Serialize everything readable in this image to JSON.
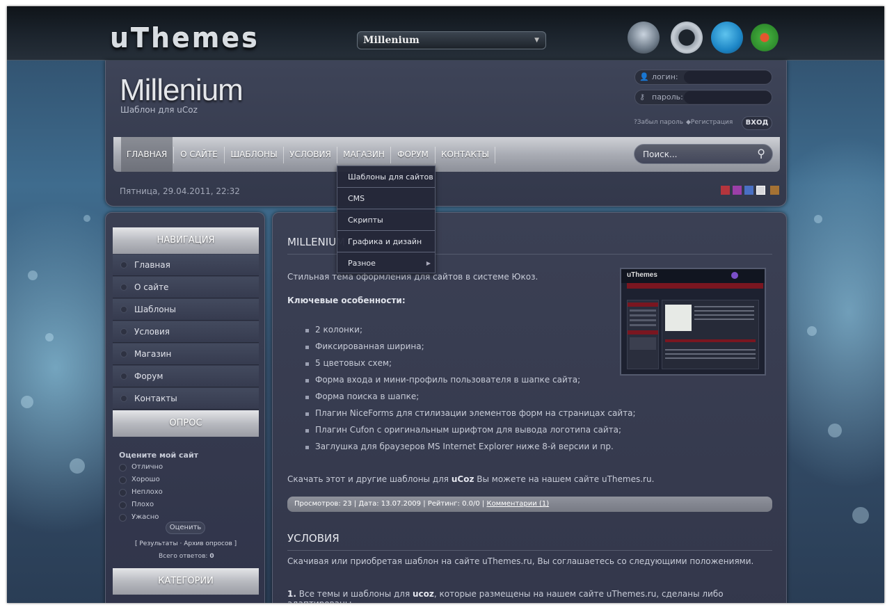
{
  "topbar": {
    "logo": "uThemes",
    "theme_select_value": "Millenium"
  },
  "header": {
    "site_title": "Millenium",
    "site_subtitle": "Шаблон для uCoz",
    "login_label": "логин:",
    "password_label": "пароль:",
    "forgot_link": "Забыл пароль",
    "register_link": "Регистрация",
    "login_button": "ВХОД",
    "search_placeholder": "Поиск...",
    "date": "Пятница, 29.04.2011, 22:32",
    "color_swatches": [
      "#b4353d",
      "#9b3fa8",
      "#4a70c4",
      "#d8d8dc",
      "#a57234"
    ]
  },
  "menu": {
    "items": [
      "ГЛАВНАЯ",
      "О САЙТЕ",
      "ШАБЛОНЫ",
      "УСЛОВИЯ",
      "МАГАЗИН",
      "ФОРУМ",
      "КОНТАКТЫ"
    ],
    "dropdown": [
      "Шаблоны для сайтов",
      "CMS",
      "Скрипты",
      "Графика и дизайн",
      "Разное"
    ]
  },
  "sidebar": {
    "nav_title": "НАВИГАЦИЯ",
    "nav_items": [
      "Главная",
      "О сайте",
      "Шаблоны",
      "Условия",
      "Магазин",
      "Форум",
      "Контакты"
    ],
    "poll_title": "ОПРОС",
    "poll_question": "Оцените мой сайт",
    "poll_options": [
      "Отлично",
      "Хорошо",
      "Неплохо",
      "Плохо",
      "Ужасно"
    ],
    "vote_button": "Оценить",
    "results_link": "Результаты",
    "archive_link": "Архив опросов",
    "total_label": "Всего ответов:",
    "total_value": "0",
    "categories_title": "КАТЕГОРИИ"
  },
  "content": {
    "title1": "MILLENIUM",
    "intro": "Стильная тема оформления для сайтов в системе Юкоз.",
    "features_heading": "Ключевые особенности:",
    "features": [
      "2 колонки;",
      "Фиксированная ширина;",
      "5 цветовых схем;",
      "Форма входа и мини-профиль пользователя в шапке сайта;",
      "Форма поиска в шапке;",
      "Плагин NiceForms для стилизации элементов форм на страницах сайта;",
      "Плагин Cufon с оригинальным шрифтом для вывода логотипа сайта;",
      "Заглушка для браузеров MS Internet Explorer ниже 8-й версии и пр."
    ],
    "download_prefix": "Скачать этот и другие шаблоны для",
    "download_ucoz": "uCoz",
    "download_mid": "Вы можете на нашем сайте",
    "download_site": "uThemes.ru",
    "meta": "Просмотров: 23 | Дата: 13.07.2009 | Рейтинг: 0.0/0 |",
    "comments_link": "Комментарии (1)",
    "title2": "УСЛОВИЯ",
    "terms_intro": "Скачивая или приобретая шаблон на сайте uThemes.ru, Вы соглашаетесь со следующими положениями.",
    "terms_num": "1.",
    "terms_1_a": "Все темы и шаблоны для",
    "terms_1_b": "ucoz",
    "terms_1_c": ", которые размещены на нашем сайте uThemes.ru, сделаны либо адаптированы",
    "thumb_logo": "uThemes"
  }
}
